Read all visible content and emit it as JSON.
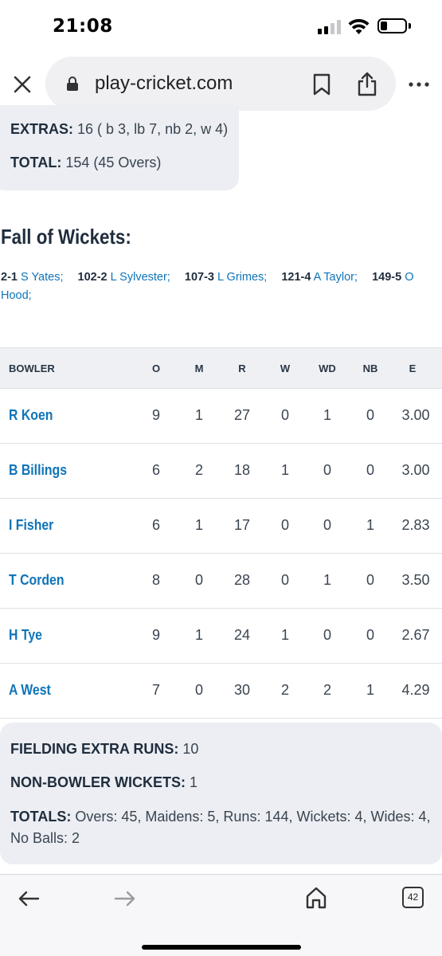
{
  "status_bar": {
    "time": "21:08"
  },
  "browser": {
    "url": "play-cricket.com",
    "tab_count": "42"
  },
  "extras": {
    "extras_label": "EXTRAS:",
    "extras_value": "16 ( b 3, lb 7, nb 2, w 4)",
    "total_label": "TOTAL:",
    "total_value": "154 (45 Overs)"
  },
  "fall_of_wickets": {
    "heading": "Fall of Wickets:",
    "items": [
      {
        "score": "2-1",
        "name": "S Yates;"
      },
      {
        "score": "102-2",
        "name": "L Sylvester;"
      },
      {
        "score": "107-3",
        "name": "L Grimes;"
      },
      {
        "score": "121-4",
        "name": "A Taylor;"
      },
      {
        "score": "149-5",
        "name": "O Hood;"
      }
    ]
  },
  "bowling": {
    "headers": [
      "BOWLER",
      "O",
      "M",
      "R",
      "W",
      "WD",
      "NB",
      "E"
    ],
    "rows": [
      {
        "bowler": "R Koen",
        "o": "9",
        "m": "1",
        "r": "27",
        "w": "0",
        "wd": "1",
        "nb": "0",
        "e": "3.00"
      },
      {
        "bowler": "B Billings",
        "o": "6",
        "m": "2",
        "r": "18",
        "w": "1",
        "wd": "0",
        "nb": "0",
        "e": "3.00"
      },
      {
        "bowler": "I Fisher",
        "o": "6",
        "m": "1",
        "r": "17",
        "w": "0",
        "wd": "0",
        "nb": "1",
        "e": "2.83"
      },
      {
        "bowler": "T Corden",
        "o": "8",
        "m": "0",
        "r": "28",
        "w": "0",
        "wd": "1",
        "nb": "0",
        "e": "3.50"
      },
      {
        "bowler": "H Tye",
        "o": "9",
        "m": "1",
        "r": "24",
        "w": "1",
        "wd": "0",
        "nb": "0",
        "e": "2.67"
      },
      {
        "bowler": "A West",
        "o": "7",
        "m": "0",
        "r": "30",
        "w": "2",
        "wd": "2",
        "nb": "1",
        "e": "4.29"
      }
    ]
  },
  "totals": {
    "fielding_label": "FIELDING EXTRA RUNS:",
    "fielding_value": "10",
    "nonbowler_label": "NON-BOWLER WICKETS:",
    "nonbowler_value": "1",
    "totals_label": "TOTALS:",
    "totals_value": "Overs: 45, Maidens: 5, Runs: 144, Wickets: 4, Wides: 4, No Balls: 2"
  },
  "colors": {
    "link_blue": "#0f74b8",
    "heading_text": "#1f2d3d",
    "card_bg": "#eceef3"
  },
  "icons": [
    "close-icon",
    "lock-icon",
    "bookmark-icon",
    "share-icon",
    "more-icon",
    "back-arrow-icon",
    "forward-arrow-icon",
    "home-icon",
    "tabs-icon"
  ]
}
